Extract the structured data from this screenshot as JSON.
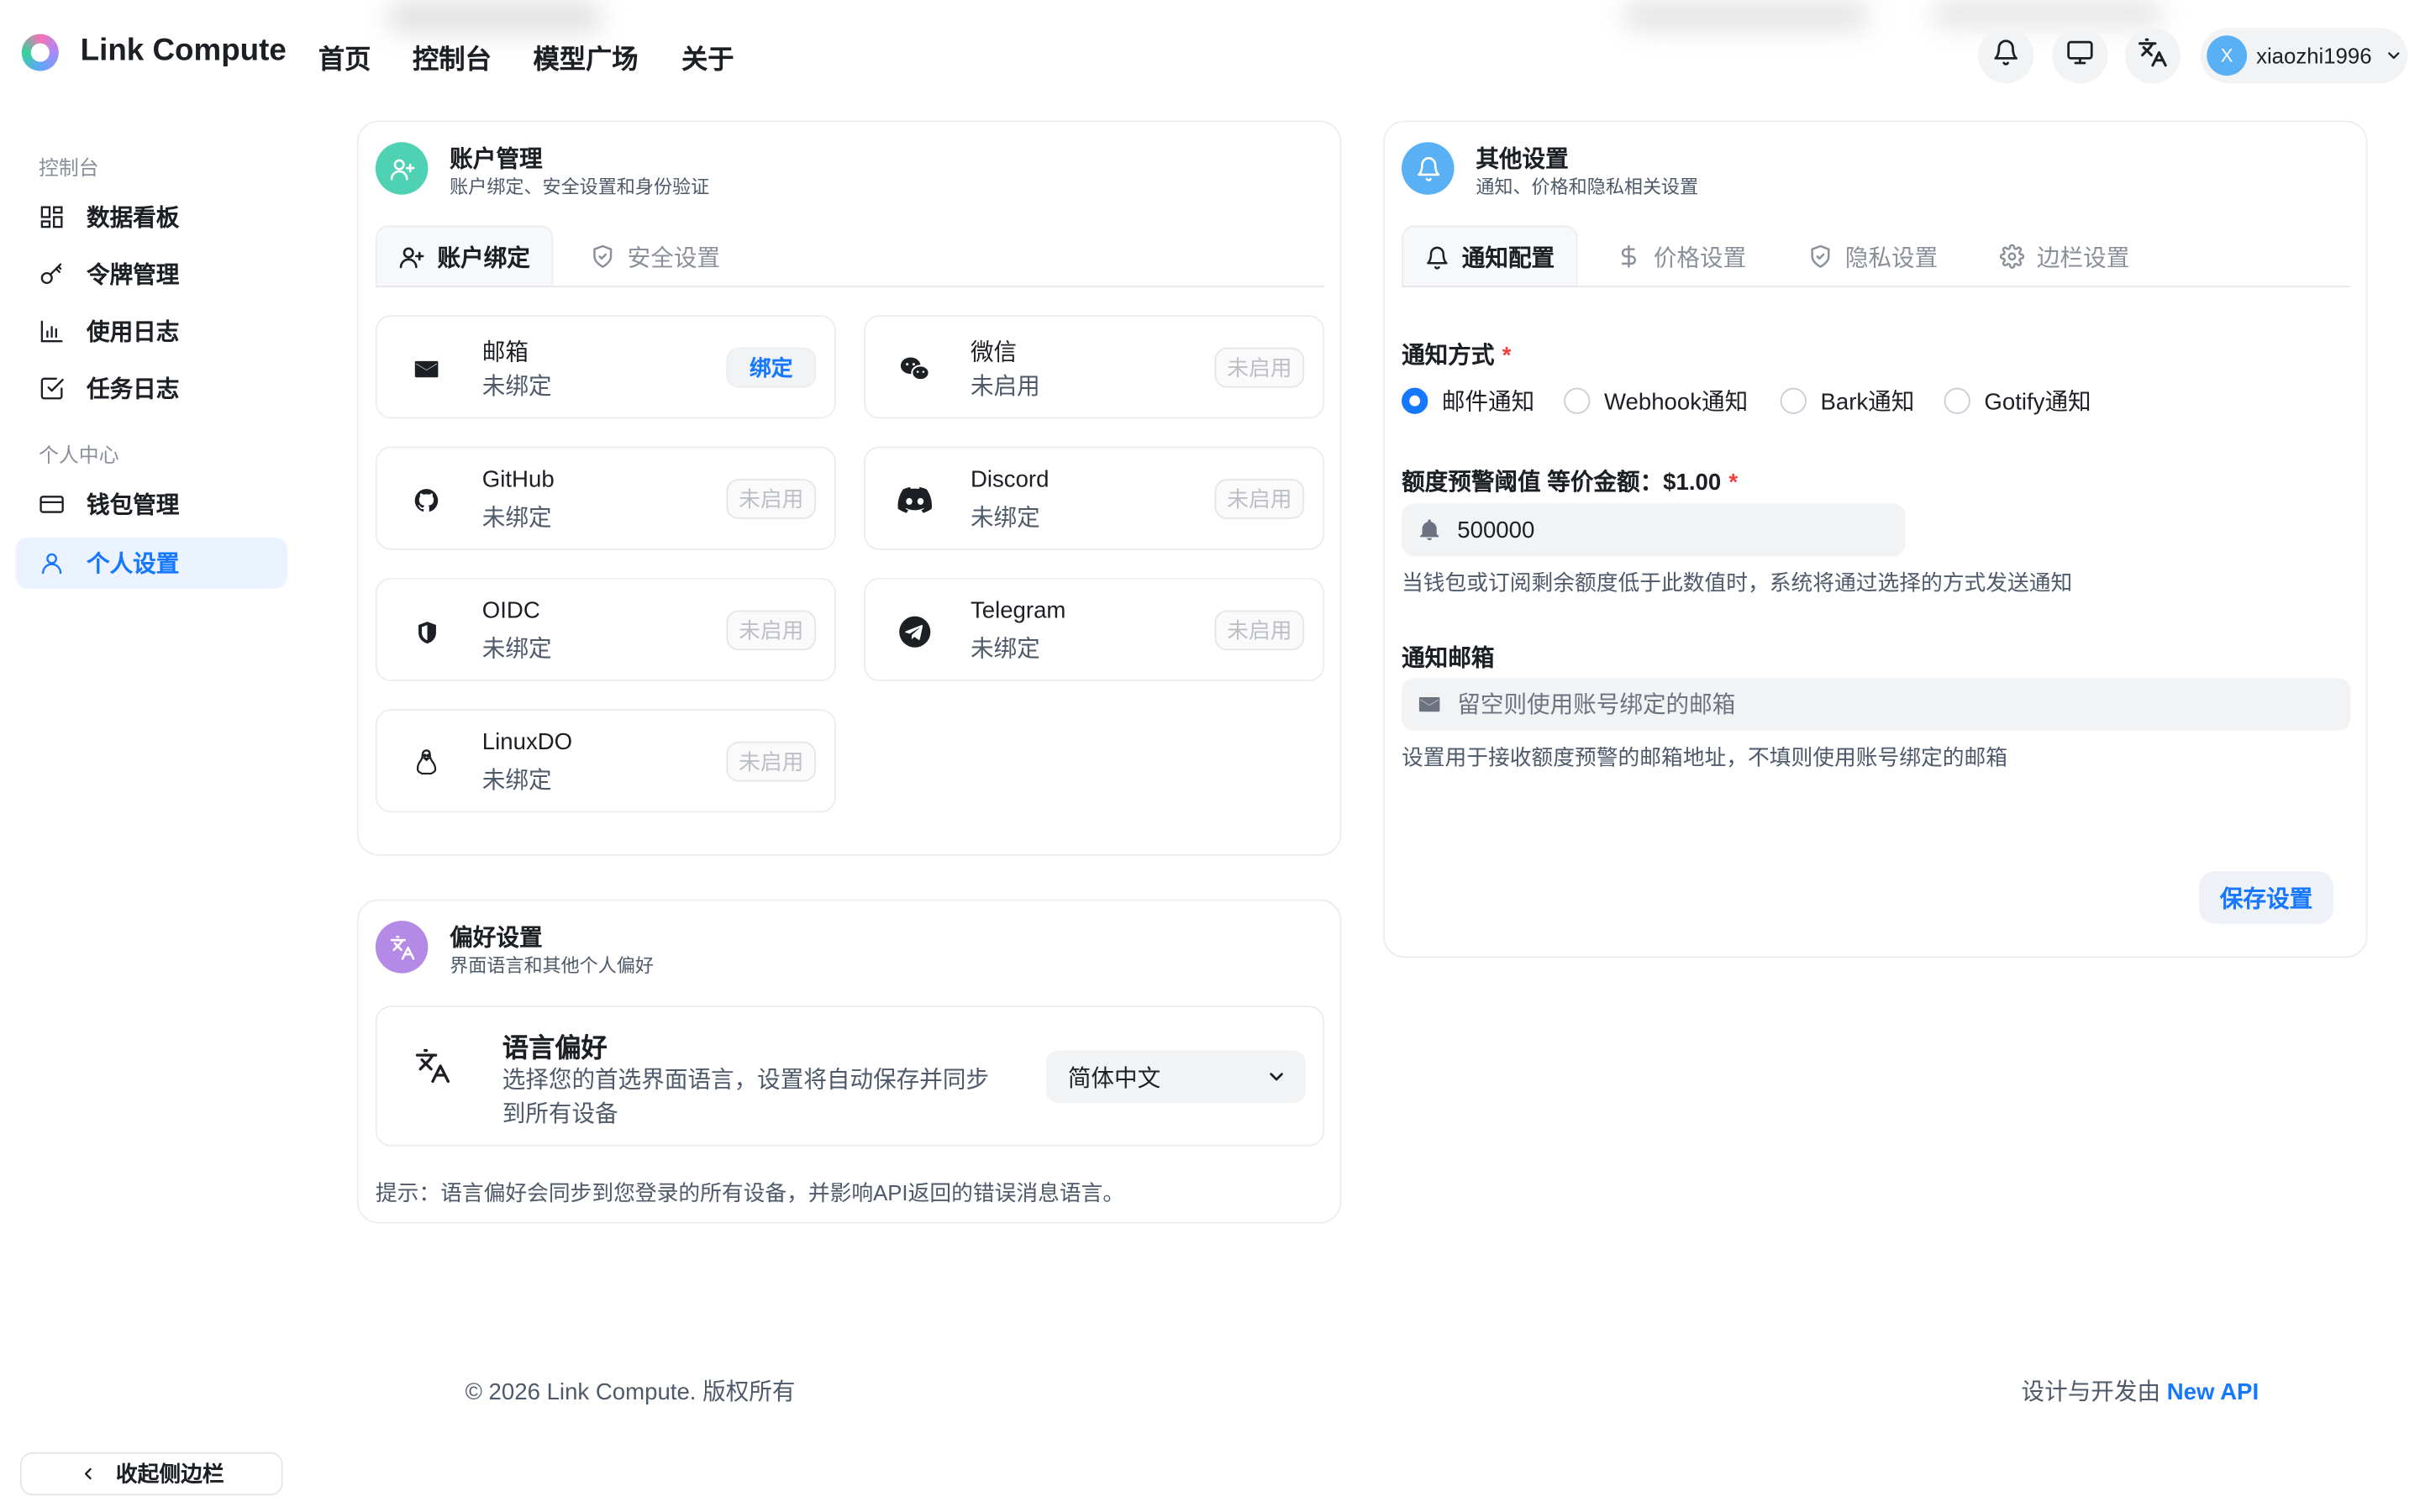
{
  "header": {
    "brand": "Link Compute",
    "nav": [
      "首页",
      "控制台",
      "模型广场",
      "关于"
    ],
    "icons": [
      "bell-icon",
      "monitor-icon",
      "translate-icon"
    ],
    "user": {
      "initial": "X",
      "name": "xiaozhi1996"
    }
  },
  "sidebar": {
    "group1": "控制台",
    "items1": [
      "数据看板",
      "令牌管理",
      "使用日志",
      "任务日志"
    ],
    "group2": "个人中心",
    "items2": [
      "钱包管理",
      "个人设置"
    ],
    "active": "个人设置",
    "collapse": "收起侧边栏"
  },
  "account": {
    "title": "账户管理",
    "subtitle": "账户绑定、安全设置和身份验证",
    "tabs": [
      "账户绑定",
      "安全设置"
    ],
    "bindings": [
      {
        "name": "邮箱",
        "status": "未绑定",
        "action": "绑定",
        "icon": "mail-icon"
      },
      {
        "name": "微信",
        "status": "未启用",
        "action": "未启用",
        "icon": "wechat-icon"
      },
      {
        "name": "GitHub",
        "status": "未绑定",
        "action": "未启用",
        "icon": "github-icon"
      },
      {
        "name": "Discord",
        "status": "未绑定",
        "action": "未启用",
        "icon": "discord-icon"
      },
      {
        "name": "OIDC",
        "status": "未绑定",
        "action": "未启用",
        "icon": "shield-icon"
      },
      {
        "name": "Telegram",
        "status": "未绑定",
        "action": "未启用",
        "icon": "telegram-icon"
      },
      {
        "name": "LinuxDO",
        "status": "未绑定",
        "action": "未启用",
        "icon": "linux-icon"
      }
    ]
  },
  "preferences": {
    "title": "偏好设置",
    "subtitle": "界面语言和其他个人偏好",
    "language_title": "语言偏好",
    "language_desc_line1": "选择您的首选界面语言，设置将自动保存并同步",
    "language_desc_line2": "到所有设备",
    "language_value": "简体中文",
    "tip": "提示：语言偏好会同步到您登录的所有设备，并影响API返回的错误消息语言。"
  },
  "other": {
    "title": "其他设置",
    "subtitle": "通知、价格和隐私相关设置",
    "tabs": [
      "通知配置",
      "价格设置",
      "隐私设置",
      "边栏设置"
    ],
    "notify_method_label": "通知方式",
    "notify_methods": [
      "邮件通知",
      "Webhook通知",
      "Bark通知",
      "Gotify通知"
    ],
    "threshold_label": "额度预警阈值 等价金额：$1.00",
    "threshold_value": "500000",
    "threshold_help": "当钱包或订阅剩余额度低于此数值时，系统将通过选择的方式发送通知",
    "email_label": "通知邮箱",
    "email_placeholder": "留空则使用账号绑定的邮箱",
    "email_help": "设置用于接收额度预警的邮箱地址，不填则使用账号绑定的邮箱",
    "save": "保存设置"
  },
  "footer": {
    "copyright": "© 2026 Link Compute. 版权所有",
    "credit_prefix": "设计与开发由",
    "credit_link": "New API"
  }
}
